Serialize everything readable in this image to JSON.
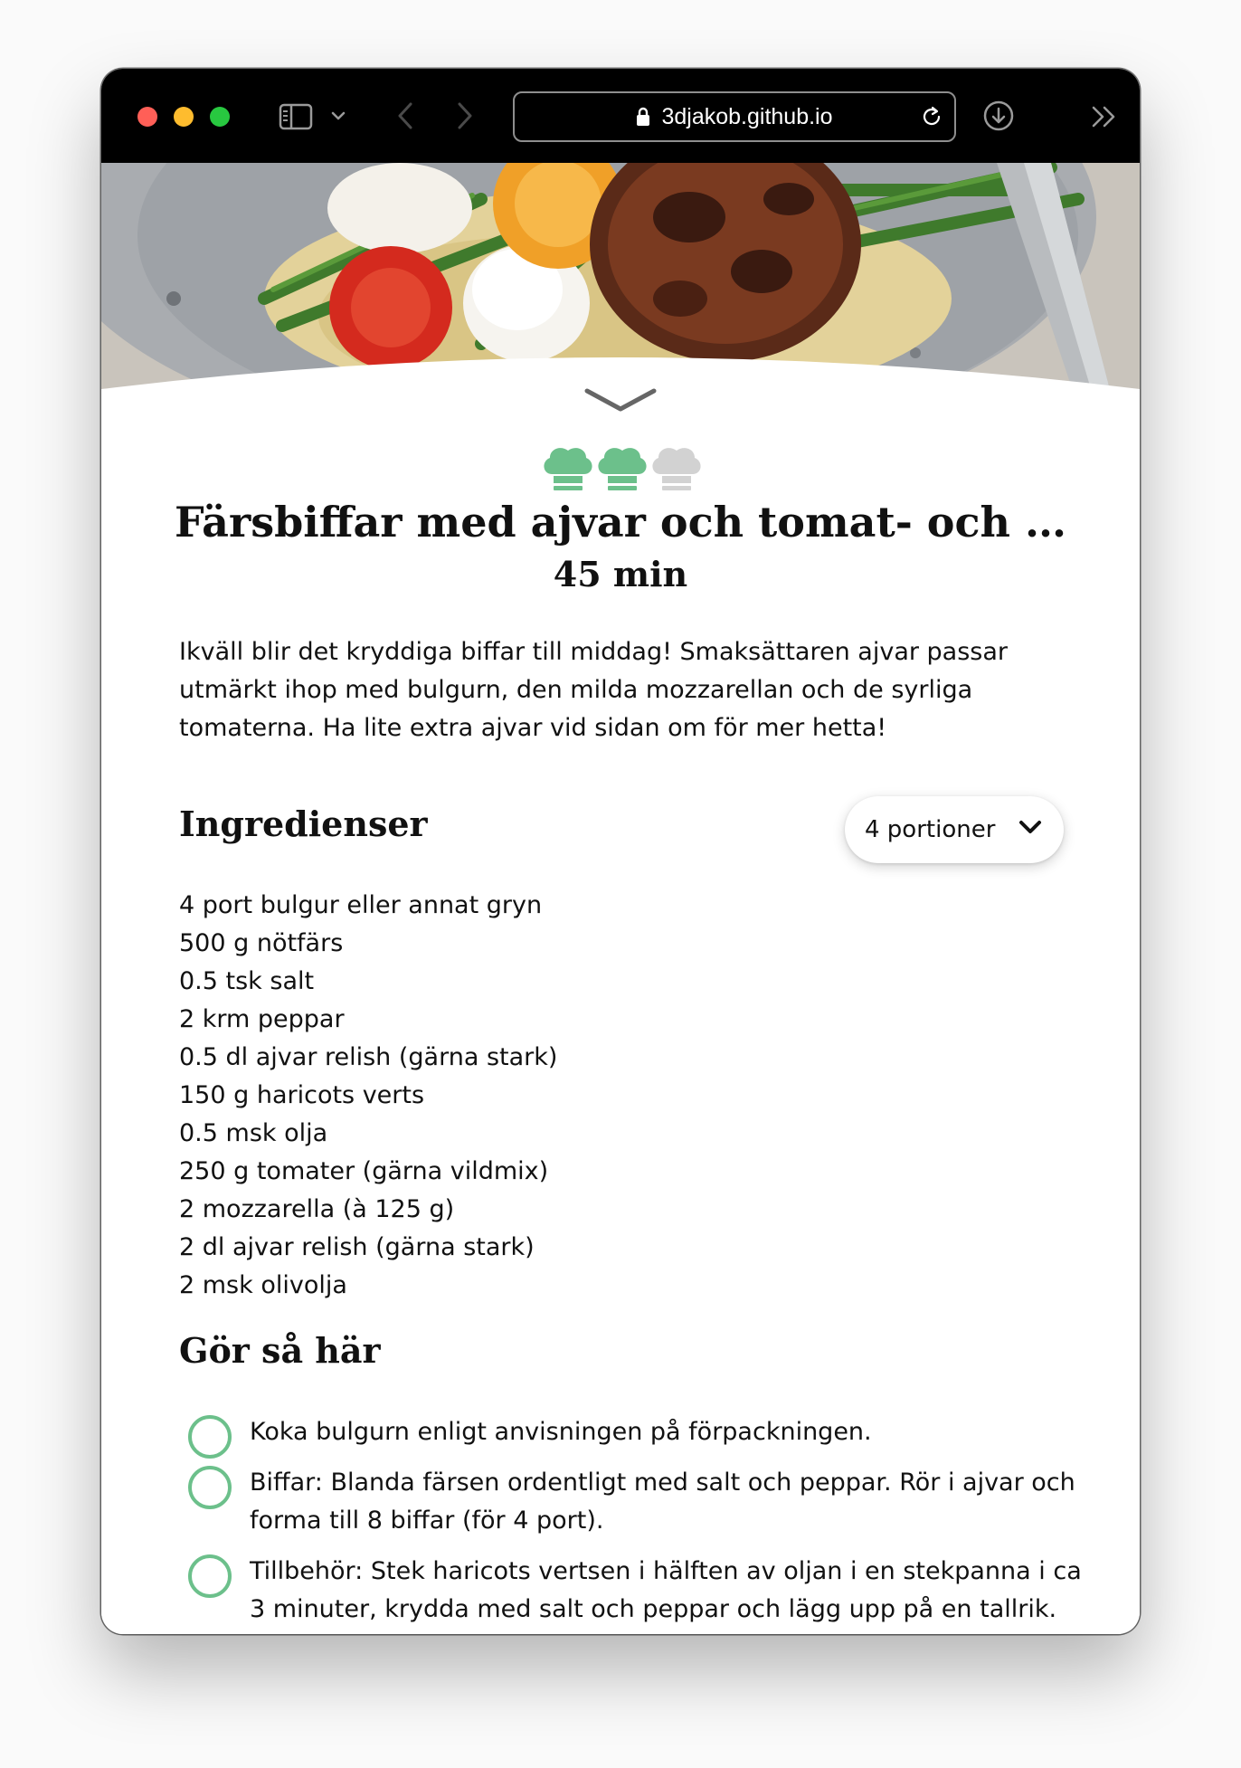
{
  "browser": {
    "url": "3djakob.github.io",
    "icons": [
      "sidebar-icon",
      "chevron-down-icon",
      "back-icon",
      "forward-icon",
      "lock-icon",
      "reload-icon",
      "download-icon",
      "overflow-icon"
    ]
  },
  "recipe": {
    "difficulty_level": 2,
    "difficulty_max": 3,
    "title": "Färsbiffar med ajvar och tomat- och …",
    "time": "45 min",
    "description": "Ikväll blir det kryddiga biffar till middag! Smaksättaren ajvar passar utmärkt ihop med bulgurn, den milda mozzarellan och de syrliga tomaterna. Ha lite extra ajvar vid sidan om för mer hetta!",
    "ingredients_heading": "Ingredienser",
    "portions_selected": "4 portioner",
    "ingredients": [
      "4 port bulgur eller annat gryn",
      "500 g nötfärs",
      "0.5 tsk salt",
      "2 krm peppar",
      "0.5 dl ajvar relish (gärna stark)",
      "150 g haricots verts",
      "0.5 msk olja",
      "250 g tomater (gärna vildmix)",
      "2 mozzarella (à 125 g)",
      "2 dl ajvar relish (gärna stark)",
      "2 msk olivolja"
    ],
    "steps_heading": "Gör så här",
    "steps": [
      "Koka bulgurn enligt anvisningen på förpackningen.",
      "Biffar: Blanda färsen ordentligt med salt och peppar. Rör i ajvar och forma till 8 biffar (för 4 port).",
      "Tillbehör: Stek haricots vertsen i hälften av oljan i en stekpanna i ca 3 minuter, krydda med salt och peppar och lägg upp på en tallrik."
    ]
  },
  "colors": {
    "accent_green": "#6cc08b",
    "inactive_gray": "#d2d2d2",
    "toolbar_bg": "#000000"
  }
}
